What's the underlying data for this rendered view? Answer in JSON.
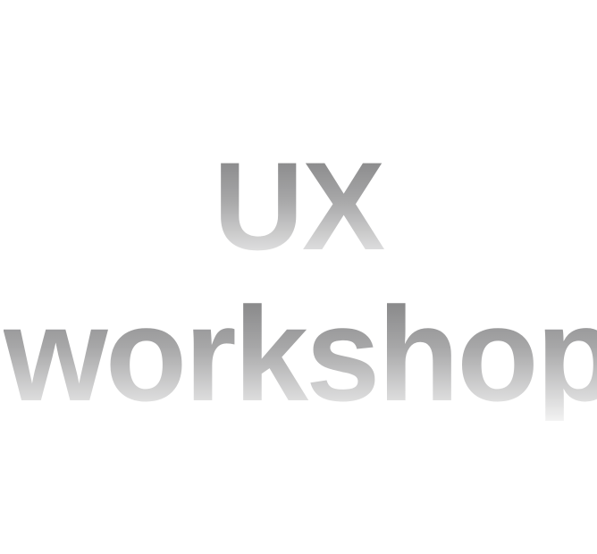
{
  "title": {
    "line1": "UX",
    "line2": "workshop"
  }
}
